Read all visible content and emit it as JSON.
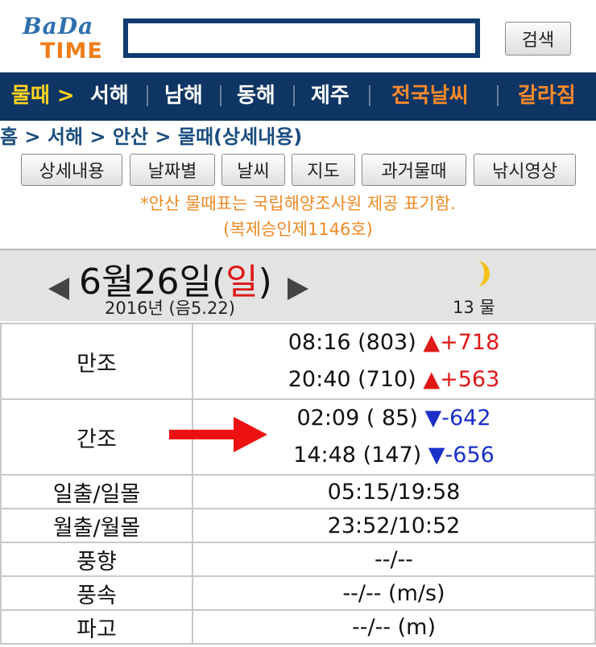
{
  "header": {
    "logo_top": "BaDa",
    "logo_bottom": "TIME",
    "search_value": "",
    "search_button": "검색"
  },
  "nav": {
    "items": [
      "물때 >",
      "서해",
      "남해",
      "동해",
      "제주",
      "전국날씨",
      "갈라짐"
    ],
    "colors": {
      "active": "#ffd21f",
      "normal": "#ffffff",
      "highlight": "#ff8a2a",
      "background": "#0e3563"
    }
  },
  "breadcrumb": "홈 > 서해 > 안산 > 물때(상세내용)",
  "sub_buttons": [
    "상세내용",
    "날짜별",
    "날씨",
    "지도",
    "과거물때",
    "낚시영상"
  ],
  "notice": {
    "line1": "*안산 물때표는 국립해양조사원 제공 표기함.",
    "line2": "(복제승인제1146호)"
  },
  "date": {
    "main": "6월26일(",
    "day": "일",
    "close": ")",
    "sub": "2016년 (음5.22)",
    "tide_age": "13 물",
    "moon_icon": "half-moon-icon"
  },
  "table": {
    "high_tide": {
      "label": "만조",
      "rows": [
        {
          "time": "08:16 (803)",
          "change": "▲+718"
        },
        {
          "time": "20:40 (710)",
          "change": "▲+563"
        }
      ]
    },
    "low_tide": {
      "label": "간조",
      "rows": [
        {
          "time": "02:09 ( 85)",
          "change": "▼-642"
        },
        {
          "time": "14:48 (147)",
          "change": "▼-656"
        }
      ]
    },
    "sun": {
      "label": "일출/일몰",
      "value": "05:15/19:58"
    },
    "moonrise": {
      "label": "월출/월몰",
      "value": "23:52/10:52"
    },
    "wind_dir": {
      "label": "풍향",
      "value": "--/--"
    },
    "wind_speed": {
      "label": "풍속",
      "value": "--/-- (m/s)"
    },
    "wave": {
      "label": "파고",
      "value": "--/-- (m)"
    }
  }
}
